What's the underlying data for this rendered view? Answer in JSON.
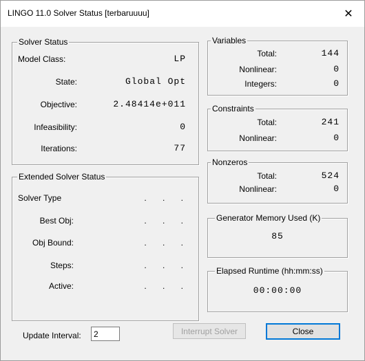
{
  "window": {
    "title": "LINGO 11.0 Solver Status [terbaruuuu]",
    "close_glyph": "✕"
  },
  "solver_status": {
    "title": "Solver Status",
    "model_class_label": "Model Class:",
    "model_class_value": "LP",
    "state_label": "State:",
    "state_value": "Global Opt",
    "objective_label": "Objective:",
    "objective_value": "2.48414e+011",
    "infeasibility_label": "Infeasibility:",
    "infeasibility_value": "0",
    "iterations_label": "Iterations:",
    "iterations_value": "77"
  },
  "extended_status": {
    "title": "Extended Solver Status",
    "rows": [
      {
        "label": "Solver Type",
        "value": ". . ."
      },
      {
        "label": "Best Obj:",
        "value": ". . ."
      },
      {
        "label": "Obj Bound:",
        "value": ". . ."
      },
      {
        "label": "Steps:",
        "value": ". . ."
      },
      {
        "label": "Active:",
        "value": ". . ."
      }
    ]
  },
  "variables": {
    "title": "Variables",
    "total_label": "Total:",
    "total_value": "144",
    "nonlinear_label": "Nonlinear:",
    "nonlinear_value": "0",
    "integers_label": "Integers:",
    "integers_value": "0"
  },
  "constraints": {
    "title": "Constraints",
    "total_label": "Total:",
    "total_value": "241",
    "nonlinear_label": "Nonlinear:",
    "nonlinear_value": "0"
  },
  "nonzeros": {
    "title": "Nonzeros",
    "total_label": "Total:",
    "total_value": "524",
    "nonlinear_label": "Nonlinear:",
    "nonlinear_value": "0"
  },
  "generator_memory": {
    "title": "Generator Memory Used (K)",
    "value": "85"
  },
  "elapsed_runtime": {
    "title": "Elapsed Runtime (hh:mm:ss)",
    "value": "00:00:00"
  },
  "footer": {
    "update_interval_label": "Update Interval:",
    "update_interval_value": "2",
    "interrupt_label": "Interrupt Solver",
    "close_label": "Close"
  }
}
